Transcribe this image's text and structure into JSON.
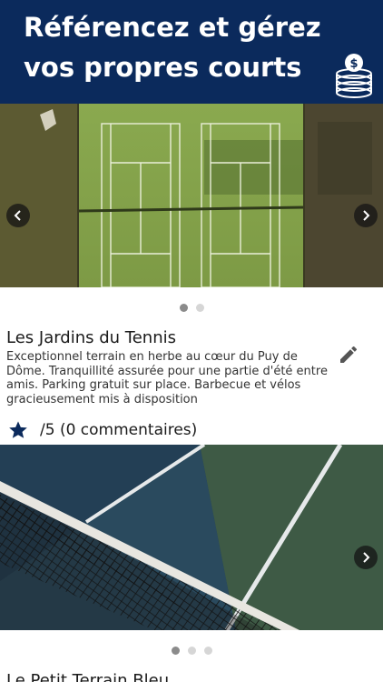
{
  "header": {
    "title": "Référencez et gérez vos propres courts",
    "icon": "coins-icon"
  },
  "courts": [
    {
      "name": "Les Jardins du Tennis",
      "description": "Exceptionnel terrain en herbe au cœur du Puy de Dôme. Tranquillité assurée pour une partie d'été entre amis. Parking gratuit sur place. Barbecue et vélos gracieusement mis à disposition",
      "rating_text": "/5 (0 commentaires)",
      "carousel_dots": 2,
      "active_dot": 0
    },
    {
      "name": "Le Petit Terrain Bleu",
      "carousel_dots": 3,
      "active_dot": 0
    }
  ],
  "colors": {
    "header_bg": "#0b2a5c",
    "star": "#0b2a5c",
    "dot_active": "#8b8b8b",
    "dot_inactive": "#d6d6d6"
  }
}
